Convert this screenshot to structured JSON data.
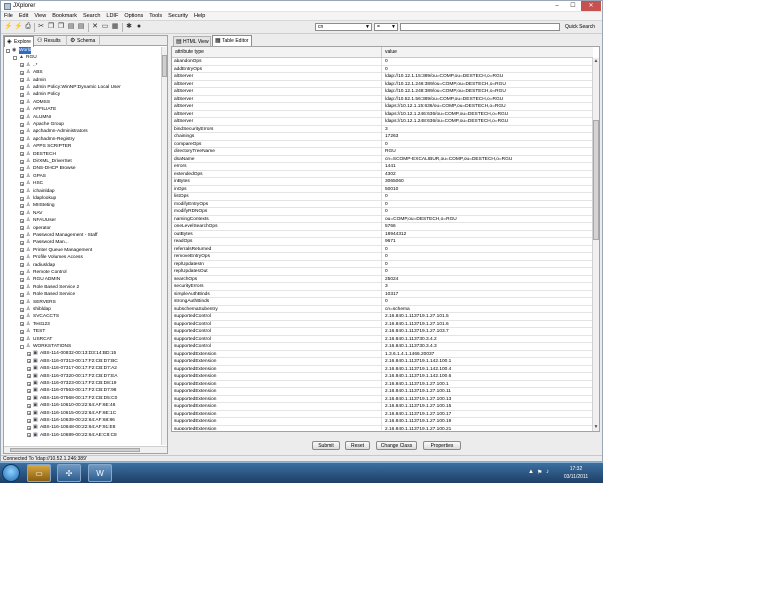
{
  "window": {
    "title": "JXplorer",
    "min": "–",
    "max": "☐",
    "close": "✕"
  },
  "menu": [
    "File",
    "Edit",
    "View",
    "Bookmark",
    "Search",
    "LDIF",
    "Options",
    "Tools",
    "Security",
    "Help"
  ],
  "toolbar": {
    "search_attr": "cn",
    "search_op": "=",
    "search_value": "",
    "quick_search": "Quick Search"
  },
  "left_tabs": [
    "Explore",
    "Results",
    "Schema"
  ],
  "tree": [
    {
      "label": "World",
      "level": 0,
      "exp": "-",
      "icon": "globe-icon",
      "selected": true
    },
    {
      "label": "RGU",
      "level": 1,
      "exp": "-",
      "icon": "org-icon"
    },
    {
      "label": "..*",
      "level": 2,
      "exp": "+",
      "icon": "person-icon"
    },
    {
      "label": "ABS",
      "level": 2,
      "exp": "+",
      "icon": "person-icon"
    },
    {
      "label": "admin",
      "level": 2,
      "exp": "+",
      "icon": "person-icon"
    },
    {
      "label": "admin Policy:WinNP:Dynamic Local User",
      "level": 2,
      "exp": "+",
      "icon": "person-icon"
    },
    {
      "label": "admin Policy",
      "level": 2,
      "exp": "+",
      "icon": "person-icon"
    },
    {
      "label": "ADMSS",
      "level": 2,
      "exp": "+",
      "icon": "person-icon"
    },
    {
      "label": "AFFILIATE",
      "level": 2,
      "exp": "+",
      "icon": "person-icon"
    },
    {
      "label": "ALUMNI",
      "level": 2,
      "exp": "+",
      "icon": "person-icon"
    },
    {
      "label": "Apache Group",
      "level": 2,
      "exp": "+",
      "icon": "person-icon"
    },
    {
      "label": "apchadmn-Administrators",
      "level": 2,
      "exp": "+",
      "icon": "person-icon"
    },
    {
      "label": "apchadmn-Registry",
      "level": 2,
      "exp": "+",
      "icon": "person-icon"
    },
    {
      "label": "APPS SCRIPTER",
      "level": 2,
      "exp": "+",
      "icon": "person-icon"
    },
    {
      "label": "DESTECH",
      "level": 2,
      "exp": "+",
      "icon": "person-icon"
    },
    {
      "label": "DirXML_DriverSet",
      "level": 2,
      "exp": "+",
      "icon": "person-icon"
    },
    {
      "label": "DNS-DHCP Browse",
      "level": 2,
      "exp": "+",
      "icon": "person-icon"
    },
    {
      "label": "GPAS",
      "level": 2,
      "exp": "+",
      "icon": "person-icon"
    },
    {
      "label": "HSC",
      "level": 2,
      "exp": "+",
      "icon": "person-icon"
    },
    {
      "label": "ichainldap",
      "level": 2,
      "exp": "+",
      "icon": "person-icon"
    },
    {
      "label": "ldaplookup",
      "level": 2,
      "exp": "+",
      "icon": "person-icon"
    },
    {
      "label": "MIISteting",
      "level": 2,
      "exp": "+",
      "icon": "person-icon"
    },
    {
      "label": "NAV",
      "level": 2,
      "exp": "+",
      "icon": "person-icon"
    },
    {
      "label": "NFAUUser",
      "level": 2,
      "exp": "+",
      "icon": "person-icon"
    },
    {
      "label": "operator",
      "level": 2,
      "exp": "+",
      "icon": "person-icon"
    },
    {
      "label": "Password Management - Staff",
      "level": 2,
      "exp": "+",
      "icon": "person-icon"
    },
    {
      "label": "Password Man...",
      "level": 2,
      "exp": "+",
      "icon": "person-icon"
    },
    {
      "label": "Printer Queue Management",
      "level": 2,
      "exp": "+",
      "icon": "person-icon"
    },
    {
      "label": "Profile Volumes Access",
      "level": 2,
      "exp": "+",
      "icon": "person-icon"
    },
    {
      "label": "radiusldap",
      "level": 2,
      "exp": "+",
      "icon": "person-icon"
    },
    {
      "label": "Remote Control",
      "level": 2,
      "exp": "+",
      "icon": "person-icon"
    },
    {
      "label": "RGU ADMIN",
      "level": 2,
      "exp": "+",
      "icon": "person-icon"
    },
    {
      "label": "Role Based Service 2",
      "level": 2,
      "exp": "+",
      "icon": "person-icon"
    },
    {
      "label": "Role Based Service",
      "level": 2,
      "exp": "+",
      "icon": "person-icon"
    },
    {
      "label": "SERVERS",
      "level": 2,
      "exp": "+",
      "icon": "person-icon"
    },
    {
      "label": "shibldap",
      "level": 2,
      "exp": "+",
      "icon": "person-icon"
    },
    {
      "label": "SVCACCTS",
      "level": 2,
      "exp": "+",
      "icon": "person-icon"
    },
    {
      "label": "Test123",
      "level": 2,
      "exp": "+",
      "icon": "person-icon"
    },
    {
      "label": "TEST",
      "level": 2,
      "exp": "+",
      "icon": "person-icon"
    },
    {
      "label": "USRCAT",
      "level": 2,
      "exp": "+",
      "icon": "person-icon"
    },
    {
      "label": "WORKSTATIONS",
      "level": 2,
      "exp": "-",
      "icon": "person-icon"
    },
    {
      "label": "ABS-114-00832-00:13:D3:14:BD:15",
      "level": 3,
      "exp": "+",
      "icon": "computer-icon"
    },
    {
      "label": "ABS-116-07313-00:17:F2:CB:D7:BC",
      "level": 3,
      "exp": "+",
      "icon": "computer-icon"
    },
    {
      "label": "ABS-116-07317-00:17:F2:CB:D7:A2",
      "level": 3,
      "exp": "+",
      "icon": "computer-icon"
    },
    {
      "label": "ABS-116-07320-00:17:F2:CB:D7:EA",
      "level": 3,
      "exp": "+",
      "icon": "computer-icon"
    },
    {
      "label": "ABS-116-07323-00:17:F2:CB:D8:19",
      "level": 3,
      "exp": "+",
      "icon": "computer-icon"
    },
    {
      "label": "ABS-116-07563-00:17:F2:CB:D7:98",
      "level": 3,
      "exp": "+",
      "icon": "computer-icon"
    },
    {
      "label": "ABS-116-07568-00:17:F2:CB:D5:C0",
      "level": 3,
      "exp": "+",
      "icon": "computer-icon"
    },
    {
      "label": "ABS-116-10610-00:22:64:AF:6E:46",
      "level": 3,
      "exp": "+",
      "icon": "computer-icon"
    },
    {
      "label": "ABS-116-10615-00:22:64:AF:6E:1C",
      "level": 3,
      "exp": "+",
      "icon": "computer-icon"
    },
    {
      "label": "ABS-116-10639-00:22:64:AF:68:86",
      "level": 3,
      "exp": "+",
      "icon": "computer-icon"
    },
    {
      "label": "ABS-116-10648-00:22:64:AF:91:E8",
      "level": 3,
      "exp": "+",
      "icon": "computer-icon"
    },
    {
      "label": "ABS-116-10689-00:22:64:AE:C8:C8",
      "level": 3,
      "exp": "+",
      "icon": "computer-icon"
    }
  ],
  "right_tabs": [
    "HTML View",
    "Table Editor"
  ],
  "table": {
    "headers": [
      "attribute type",
      "value"
    ],
    "rows": [
      [
        "abandonOps",
        "0"
      ],
      [
        "addEntryOps",
        "0"
      ],
      [
        "altServer",
        "ldap://10.12.1.15:389/ou=COMP,ou=DESTECH,o=RGU"
      ],
      [
        "altServer",
        "ldap://10.12.1.246:389/ou=COMP,ou=DESTECH,o=RGU"
      ],
      [
        "altServer",
        "ldap://10.12.1.248:389/ou=COMP,ou=DESTECH,o=RGU"
      ],
      [
        "altServer",
        "ldap://10.52.1.56:389/ou=COMP,ou=DESTECH,o=RGU"
      ],
      [
        "altServer",
        "ldaps://10.12.1.15:636/ou=COMP,ou=DESTECH,o=RGU"
      ],
      [
        "altServer",
        "ldaps://10.12.1.246:636/ou=COMP,ou=DESTECH,o=RGU"
      ],
      [
        "altServer",
        "ldaps://10.12.1.248:636/ou=COMP,ou=DESTECH,o=RGU"
      ],
      [
        "bindSecurityErrors",
        "3"
      ],
      [
        "chainings",
        "17263"
      ],
      [
        "compareOps",
        "0"
      ],
      [
        "directoryTreeName",
        "RGU"
      ],
      [
        "dsaName",
        "cn=SCOMP-EXCALIBUR,ou=COMP,ou=DESTECH,o=RGU"
      ],
      [
        "errors",
        "1441"
      ],
      [
        "extendedOps",
        "4302"
      ],
      [
        "inBytes",
        "3065060"
      ],
      [
        "inOps",
        "50010"
      ],
      [
        "listOps",
        "0"
      ],
      [
        "modifyEntryOps",
        "0"
      ],
      [
        "modifyRDNOps",
        "0"
      ],
      [
        "namingContexts",
        "ou=COMP,ou=DESTECH,o=RGU"
      ],
      [
        "oneLevelSearchOps",
        "5766"
      ],
      [
        "outBytes",
        "18944312"
      ],
      [
        "readOps",
        "9671"
      ],
      [
        "referralsReturned",
        "0"
      ],
      [
        "removeEntryOps",
        "0"
      ],
      [
        "replUpdatesIn",
        "0"
      ],
      [
        "replUpdatesOut",
        "0"
      ],
      [
        "searchOps",
        "25024"
      ],
      [
        "securityErrors",
        "3"
      ],
      [
        "simpleAuthBinds",
        "10317"
      ],
      [
        "strongAuthBinds",
        "0"
      ],
      [
        "subschemaSubentry",
        "cn=schema"
      ],
      [
        "supportedControl",
        "2.16.840.1.113719.1.27.101.5"
      ],
      [
        "supportedControl",
        "2.16.840.1.113719.1.27.101.6"
      ],
      [
        "supportedControl",
        "2.16.840.1.113719.1.27.103.7"
      ],
      [
        "supportedControl",
        "2.16.840.1.113730.3.4.2"
      ],
      [
        "supportedControl",
        "2.16.840.1.113730.3.4.3"
      ],
      [
        "supportedExtension",
        "1.3.6.1.4.1.1466.20037"
      ],
      [
        "supportedExtension",
        "2.16.840.1.113719.1.142.100.1"
      ],
      [
        "supportedExtension",
        "2.16.840.1.113719.1.142.100.4"
      ],
      [
        "supportedExtension",
        "2.16.840.1.113719.1.142.100.6"
      ],
      [
        "supportedExtension",
        "2.16.840.1.113719.1.27.100.1"
      ],
      [
        "supportedExtension",
        "2.16.840.1.113719.1.27.100.11"
      ],
      [
        "supportedExtension",
        "2.16.840.1.113719.1.27.100.13"
      ],
      [
        "supportedExtension",
        "2.16.840.1.113719.1.27.100.15"
      ],
      [
        "supportedExtension",
        "2.16.840.1.113719.1.27.100.17"
      ],
      [
        "supportedExtension",
        "2.16.840.1.113719.1.27.100.19"
      ],
      [
        "supportedExtension",
        "2.16.840.1.113719.1.27.100.21"
      ]
    ]
  },
  "buttons": {
    "submit": "Submit",
    "reset": "Reset",
    "change_class": "Change Class",
    "properties": "Properties"
  },
  "status": "Connected To 'ldap://10.52.1.246:389'",
  "taskbar": {
    "time": "17:32",
    "date": "03/11/2011"
  }
}
